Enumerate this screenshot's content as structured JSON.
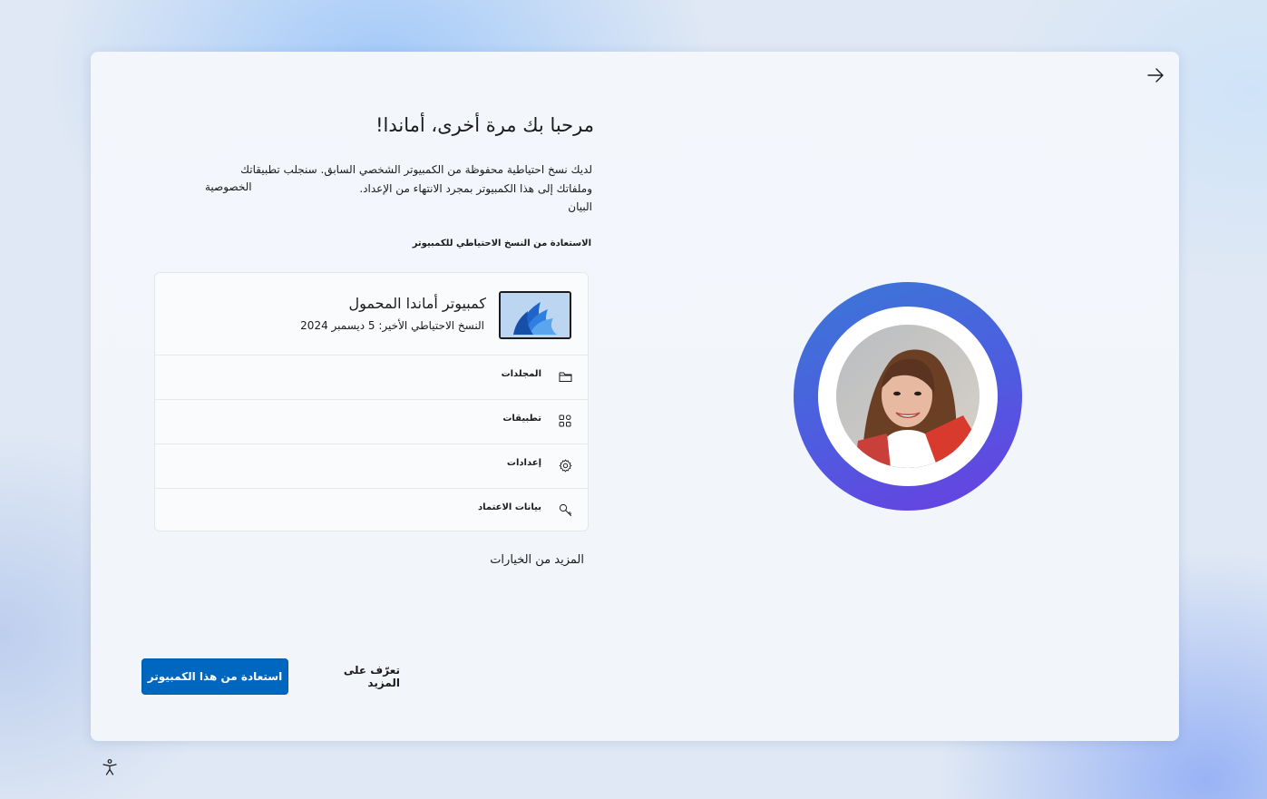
{
  "header": {
    "title": "مرحبا بك مرة أخرى، أماندا!",
    "description_line1": "لديك نسخ احتياطية محفوظة من الكمبيوتر الشخصي السابق. سنجلب تطبيقاتك",
    "description_line2": "وملفاتك إلى هذا الكمبيوتر بمجرد الانتهاء من الإعداد.",
    "description_line3": "البيان",
    "privacy_link": "الخصوصية"
  },
  "backup": {
    "section_label": "الاستعادة من النسخ الاحتياطي للكمبيوتر",
    "pc_name": "كمبيوتر أماندا المحمول",
    "last_backup": "النسخ الاحتياطي الأخير: 5 ديسمبر 2024",
    "items": [
      {
        "label": "المجلدات",
        "icon": "folder-icon"
      },
      {
        "label": "تطبيقات",
        "icon": "apps-icon"
      },
      {
        "label": "إعدادات",
        "icon": "gear-icon"
      },
      {
        "label": "بيانات الاعتماد",
        "icon": "key-icon"
      }
    ]
  },
  "more_options": "المزيد من الخيارات",
  "buttons": {
    "primary": "استعادة من هذا الكمبيوتر",
    "secondary": "تعرّف على المزيد"
  },
  "colors": {
    "accent": "#0067c0",
    "ring_start": "#3a78d6",
    "ring_end": "#6a3ee0"
  }
}
